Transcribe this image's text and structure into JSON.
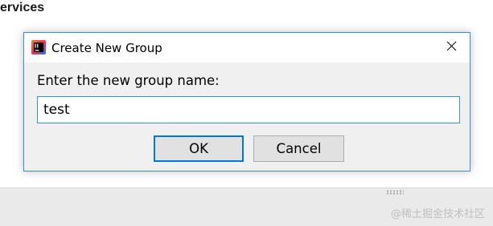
{
  "background": {
    "heading": "ervices",
    "watermark": "@稀土掘金技术社区"
  },
  "dialog": {
    "title": "Create New Group",
    "app_icon": "intellij-idea-icon",
    "close_icon": "close-icon",
    "prompt": "Enter the new group name:",
    "input_value": "test",
    "ok_label": "OK",
    "cancel_label": "Cancel"
  },
  "colors": {
    "accent": "#0078d7",
    "dialog_border": "#3c8fd6",
    "dialog_bg": "#f0f0f0",
    "button_bg": "#e1e1e1"
  }
}
